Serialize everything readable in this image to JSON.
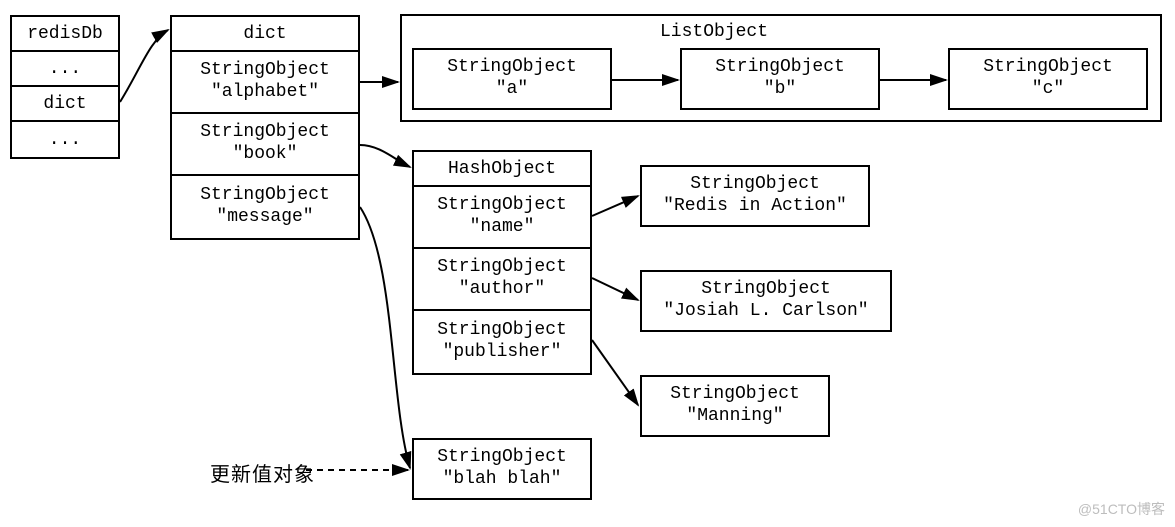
{
  "redisDb": {
    "header": "redisDb",
    "rows": [
      "...",
      "dict",
      "..."
    ]
  },
  "dict": {
    "header": "dict",
    "entries": [
      {
        "type": "StringObject",
        "value": "\"alphabet\""
      },
      {
        "type": "StringObject",
        "value": "\"book\""
      },
      {
        "type": "StringObject",
        "value": "\"message\""
      }
    ]
  },
  "listObject": {
    "title": "ListObject",
    "items": [
      {
        "type": "StringObject",
        "value": "\"a\""
      },
      {
        "type": "StringObject",
        "value": "\"b\""
      },
      {
        "type": "StringObject",
        "value": "\"c\""
      }
    ]
  },
  "hashObject": {
    "header": "HashObject",
    "fields": [
      {
        "key_type": "StringObject",
        "key": "\"name\"",
        "val_type": "StringObject",
        "val": "\"Redis in Action\""
      },
      {
        "key_type": "StringObject",
        "key": "\"author\"",
        "val_type": "StringObject",
        "val": "\"Josiah L. Carlson\""
      },
      {
        "key_type": "StringObject",
        "key": "\"publisher\"",
        "val_type": "StringObject",
        "val": "\"Manning\""
      }
    ]
  },
  "messageValue": {
    "type": "StringObject",
    "value": "\"blah blah\""
  },
  "annotation": "更新值对象",
  "watermark": "@51CTO博客"
}
